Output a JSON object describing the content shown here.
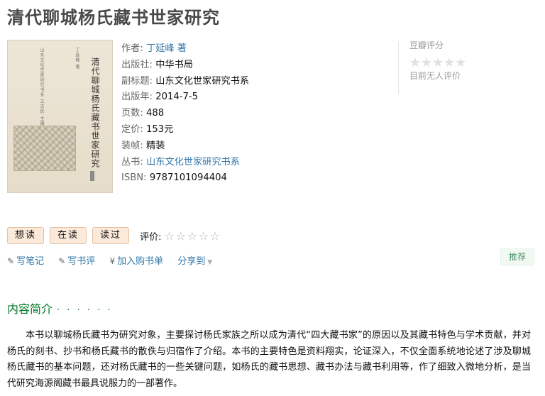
{
  "book": {
    "title": "清代聊城杨氏藏书世家研究",
    "cover": {
      "vertical_title": "清代聊城杨氏藏书世家研究",
      "spine_small_1": "山东文化世家研究书系 王志民 主编",
      "spine_small_2": "丁延峰 著"
    },
    "info": {
      "author_label": "作者:",
      "author": "丁延峰 著",
      "publisher_label": "出版社:",
      "publisher": "中华书局",
      "subtitle_label": "副标题:",
      "subtitle": "山东文化世家研究书系",
      "pubdate_label": "出版年:",
      "pubdate": "2014-7-5",
      "pages_label": "页数:",
      "pages": "488",
      "price_label": "定价:",
      "price": "153元",
      "binding_label": "装帧:",
      "binding": "精装",
      "series_label": "丛书:",
      "series": "山东文化世家研究书系",
      "isbn_label": "ISBN:",
      "isbn": "9787101094404"
    }
  },
  "rating": {
    "label": "豆瓣评分",
    "no_rating": "目前无人评价",
    "stars": [
      "★",
      "★",
      "★",
      "★",
      "★"
    ]
  },
  "user_actions": {
    "want": "想读",
    "reading": "在读",
    "read": "读过",
    "rate_label": "评价:",
    "rate_stars": [
      "☆",
      "☆",
      "☆",
      "☆",
      "☆"
    ]
  },
  "links": {
    "note": "写笔记",
    "review": "写书评",
    "cart": "加入购书单",
    "share": "分享到",
    "recommend": "推荐",
    "icons": {
      "note": "pencil-icon",
      "review": "pencil-icon",
      "cart": "yen-icon",
      "share": "chevron-down-icon"
    }
  },
  "intro": {
    "heading": "内容简介",
    "dots": "· · · · · ·",
    "text": "本书以聊城杨氏藏书为研究对象，主要探讨杨氏家族之所以成为清代“四大藏书家”的原因以及其藏书特色与学术贡献，并对杨氏的刻书、抄书和杨氏藏书的散佚与归宿作了介绍。本书的主要特色是资料翔实，论证深入，不仅全面系统地论述了涉及聊城杨氏藏书的基本问题，还对杨氏藏书的一些关键问题，如杨氏的藏书思想、藏书办法与藏书利用等，作了细致入微地分析，是当代研究海源阁藏书最具说服力的一部著作。"
  },
  "colors": {
    "link": "#3377aa",
    "section_green": "#007722",
    "button_bg": "#fbe9da",
    "button_border": "#e3c1a4",
    "recommend_bg": "#f2f8f2",
    "recommend_text": "#4f946e"
  }
}
